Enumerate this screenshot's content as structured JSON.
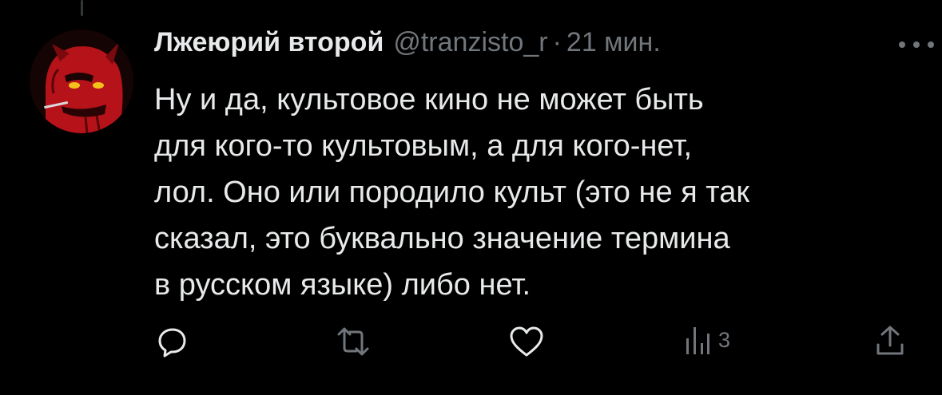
{
  "tweet": {
    "display_name": "Лжеюрий второй",
    "handle": "@tranzisto_r",
    "separator": "·",
    "time": "21 мин.",
    "text_lines": [
      "Ну и да, культовое кино не может быть",
      "для кого-то культовым, а для кого-нет,",
      "лол. Оно или породило культ (это не я так",
      "сказал, это буквально значение термина",
      "в русском языке) либо нет."
    ]
  },
  "actions": {
    "reply_icon": "reply-icon",
    "retweet_icon": "retweet-icon",
    "like_icon": "heart-icon",
    "views_icon": "views-chart-icon",
    "views_count": "3",
    "share_icon": "share-icon"
  },
  "colors": {
    "background": "#000000",
    "text_primary": "#e7e9ea",
    "text_secondary": "#71767b",
    "avatar_red": "#c8141a"
  }
}
